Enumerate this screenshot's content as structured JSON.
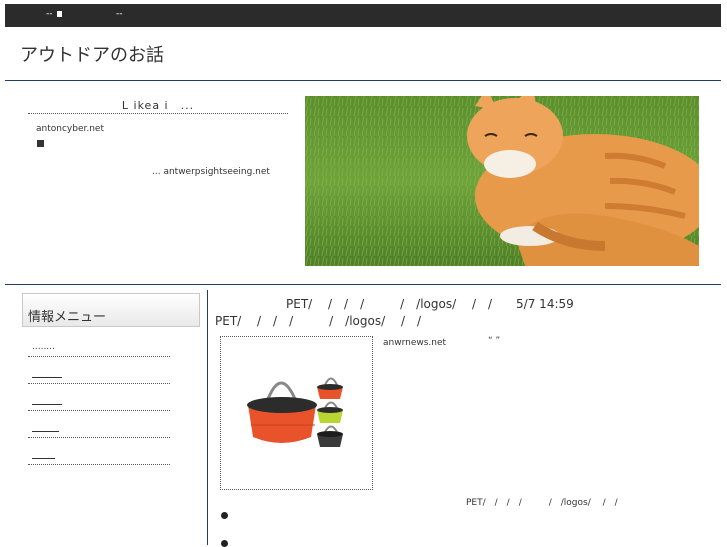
{
  "topbar": {
    "item1": "--",
    "item2": "--"
  },
  "site": {
    "title": "アウトドアのお話"
  },
  "feature": {
    "heading": "L ikea i　...",
    "domain": "antoncyber.net",
    "link": "... antwerpsightseeing.net"
  },
  "sidebar": {
    "menu_title": "情報メニュー",
    "items": [
      {
        "label": "........"
      },
      {
        "label": ""
      },
      {
        "label": ""
      },
      {
        "label": ""
      },
      {
        "label": ""
      }
    ]
  },
  "post": {
    "line1": "PET/　 /　/　/　　　/　/logos/　 /　/　　5/7 14:59",
    "line2": "PET/　 /　/　/　　　/　/logos/　 /　/",
    "source": "anwrnews.net",
    "quote": "“ ”",
    "category": "PET/　/　/　/　　　/　/logos/　 /　/"
  },
  "colors": {
    "topbar": "#2b2b2b",
    "rule": "#1f3d6b",
    "basket": "#e8532b"
  }
}
